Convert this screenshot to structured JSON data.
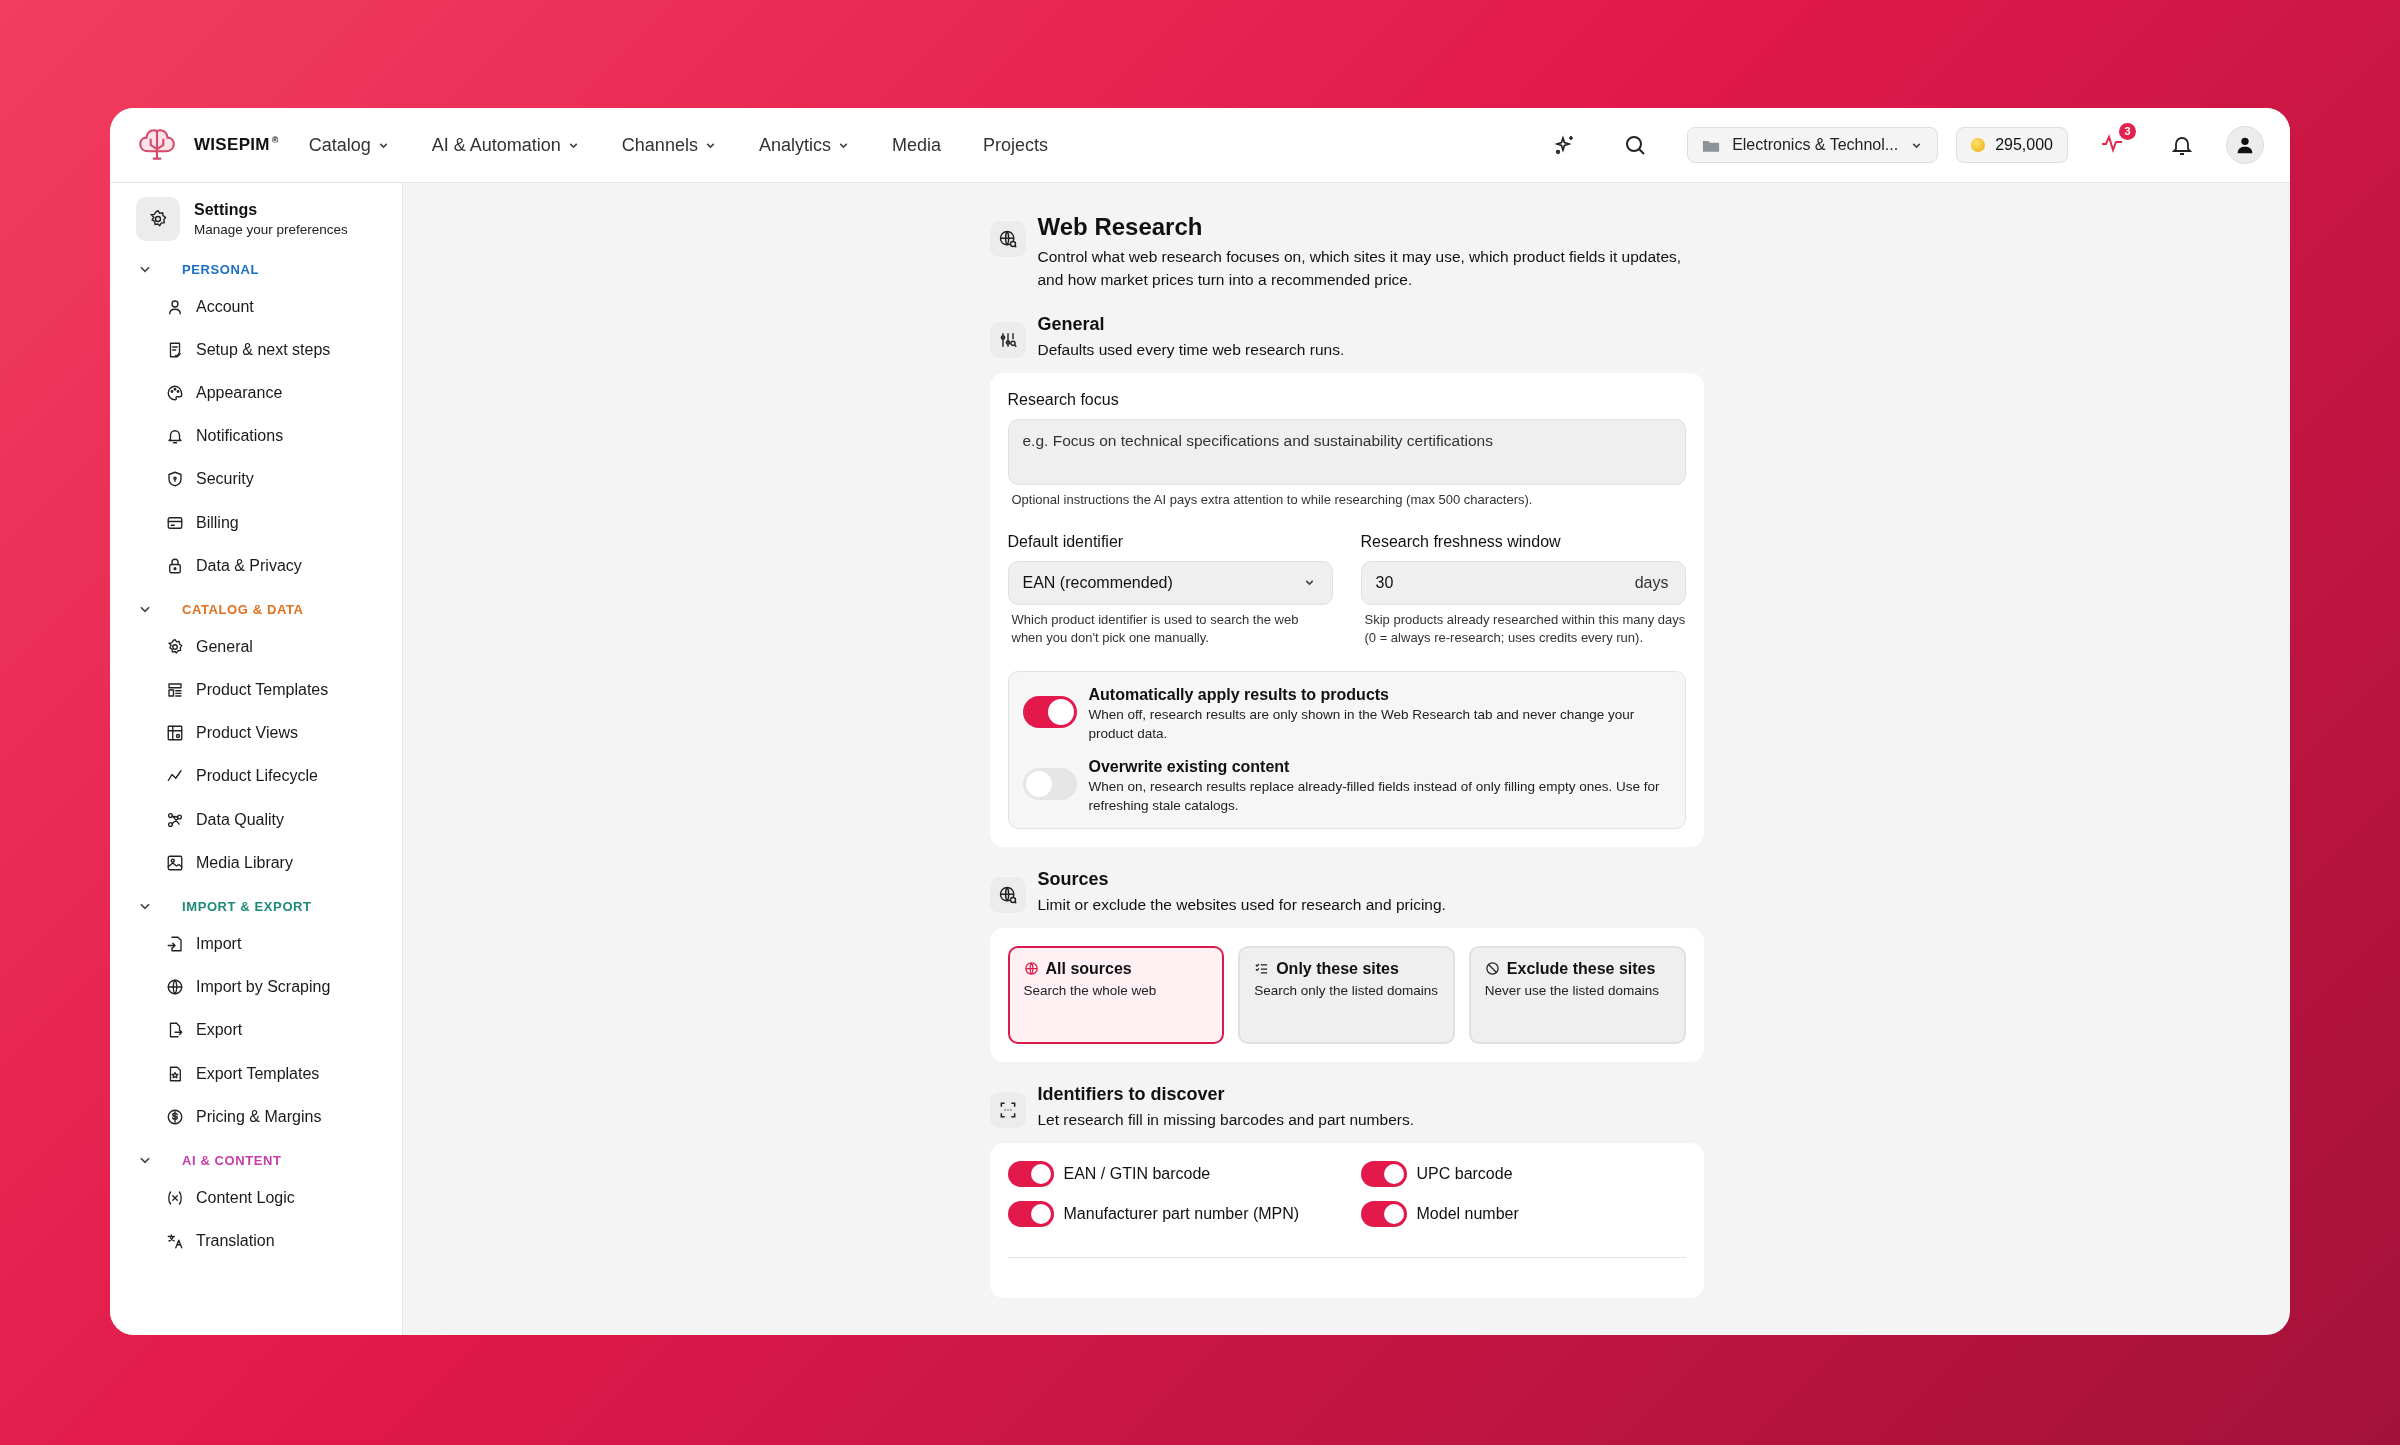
{
  "topbar": {
    "brand": "WISEPIM",
    "brand_mark": "®",
    "nav": [
      {
        "label": "Catalog",
        "dropdown": true
      },
      {
        "label": "AI & Automation",
        "dropdown": true
      },
      {
        "label": "Channels",
        "dropdown": true
      },
      {
        "label": "Analytics",
        "dropdown": true
      },
      {
        "label": "Media",
        "dropdown": false
      },
      {
        "label": "Projects",
        "dropdown": false
      }
    ],
    "workspace": "Electronics & Technol...",
    "credits": "295,000",
    "activity_badge": "3"
  },
  "sidebar": {
    "title": "Settings",
    "subtitle": "Manage your preferences",
    "groups": [
      {
        "label": "PERSONAL",
        "color": "#1d6fc4",
        "expanded": true,
        "items": [
          {
            "label": "Account"
          },
          {
            "label": "Setup & next steps"
          },
          {
            "label": "Appearance"
          },
          {
            "label": "Notifications"
          },
          {
            "label": "Security"
          },
          {
            "label": "Billing"
          },
          {
            "label": "Data & Privacy"
          }
        ]
      },
      {
        "label": "CATALOG & DATA",
        "color": "#e0701e",
        "expanded": true,
        "items": [
          {
            "label": "General"
          },
          {
            "label": "Product Templates"
          },
          {
            "label": "Product Views"
          },
          {
            "label": "Product Lifecycle"
          },
          {
            "label": "Data Quality"
          },
          {
            "label": "Media Library"
          }
        ]
      },
      {
        "label": "IMPORT & EXPORT",
        "color": "#1f8a78",
        "expanded": true,
        "items": [
          {
            "label": "Import"
          },
          {
            "label": "Import by Scraping"
          },
          {
            "label": "Export"
          },
          {
            "label": "Export Templates"
          },
          {
            "label": "Pricing & Margins"
          }
        ]
      },
      {
        "label": "AI & CONTENT",
        "color": "#c83ca8",
        "expanded": true,
        "items": [
          {
            "label": "Content Logic"
          },
          {
            "label": "Translation"
          }
        ]
      }
    ]
  },
  "page": {
    "title": "Web Research",
    "description": "Control what web research focuses on, which sites it may use, which product fields it updates, and how market prices turn into a recommended price."
  },
  "general": {
    "title": "General",
    "description": "Defaults used every time web research runs.",
    "research_focus": {
      "label": "Research focus",
      "placeholder": "e.g. Focus on technical specifications and sustainability certifications",
      "hint": "Optional instructions the AI pays extra attention to while researching (max 500 characters)."
    },
    "default_identifier": {
      "label": "Default identifier",
      "value": "EAN (recommended)",
      "hint": "Which product identifier is used to search the web when you don't pick one manually."
    },
    "freshness": {
      "label": "Research freshness window",
      "value": "30",
      "unit": "days",
      "hint": "Skip products already researched within this many days (0 = always re-research; uses credits every run)."
    },
    "toggles": [
      {
        "title": "Automatically apply results to products",
        "description": "When off, research results are only shown in the Web Research tab and never change your product data.",
        "on": true
      },
      {
        "title": "Overwrite existing content",
        "description": "When on, research results replace already-filled fields instead of only filling empty ones. Use for refreshing stale catalogs.",
        "on": false
      }
    ]
  },
  "sources": {
    "title": "Sources",
    "description": "Limit or exclude the websites used for research and pricing.",
    "options": [
      {
        "title": "All sources",
        "description": "Search the whole web",
        "selected": true
      },
      {
        "title": "Only these sites",
        "description": "Search only the listed domains",
        "selected": false
      },
      {
        "title": "Exclude these sites",
        "description": "Never use the listed domains",
        "selected": false
      }
    ]
  },
  "identifiers": {
    "title": "Identifiers to discover",
    "description": "Let research fill in missing barcodes and part numbers.",
    "toggles": [
      {
        "label": "EAN / GTIN barcode",
        "on": true
      },
      {
        "label": "UPC barcode",
        "on": true
      },
      {
        "label": "Manufacturer part number (MPN)",
        "on": true
      },
      {
        "label": "Model number",
        "on": true
      }
    ]
  }
}
